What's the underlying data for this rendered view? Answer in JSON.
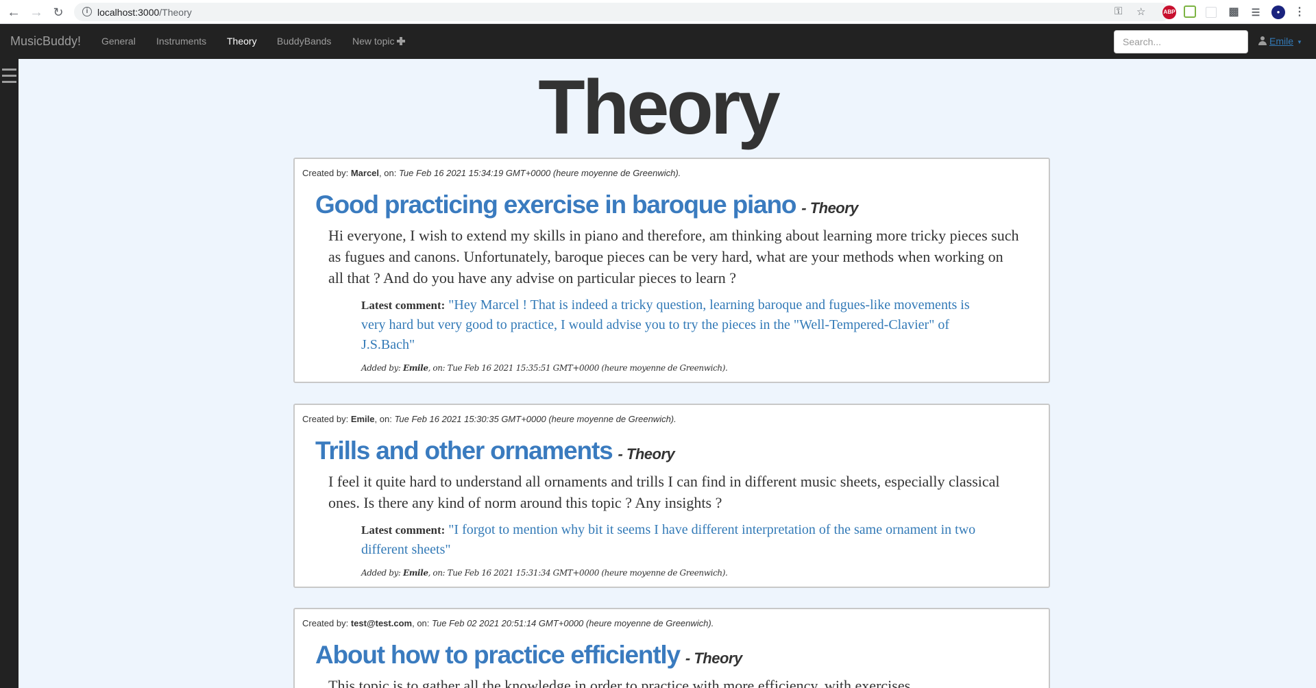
{
  "browser": {
    "url_host": "localhost:3000",
    "url_path": "/Theory"
  },
  "navbar": {
    "brand": "MusicBuddy!",
    "items": [
      {
        "label": "General",
        "active": false
      },
      {
        "label": "Instruments",
        "active": false
      },
      {
        "label": "Theory",
        "active": true
      },
      {
        "label": "BuddyBands",
        "active": false
      },
      {
        "label": "New topic",
        "active": false
      }
    ],
    "search_placeholder": "Search...",
    "user": "Emile"
  },
  "page": {
    "title": "Theory"
  },
  "posts": [
    {
      "created_label": "Created by: ",
      "author": "Marcel",
      "on_label": ", on: ",
      "date": "Tue Feb 16 2021 15:34:19 GMT+0000 (heure moyenne de Greenwich).",
      "title": "Good practicing exercise in baroque piano",
      "category": "- Theory",
      "body": "Hi everyone, I wish to extend my skills in piano and therefore, am thinking about learning more tricky pieces such as fugues and canons. Unfortunately, baroque pieces can be very hard, what are your methods when working on all that ? And do you have any advise on particular pieces to learn ?",
      "comment_label": "Latest comment:",
      "comment": "\"Hey Marcel ! That is indeed a tricky question, learning baroque and fugues-like movements is very hard but very good to practice, I would advise you to try the pieces in the \"Well-Tempered-Clavier\" of J.S.Bach\"",
      "added_label": "Added by: ",
      "added_author": "Emile",
      "added_on_label": ", on: ",
      "added_date": "Tue Feb 16 2021 15:35:51 GMT+0000 (heure moyenne de Greenwich)."
    },
    {
      "created_label": "Created by: ",
      "author": "Emile",
      "on_label": ", on: ",
      "date": "Tue Feb 16 2021 15:30:35 GMT+0000 (heure moyenne de Greenwich).",
      "title": "Trills and other ornaments",
      "category": "- Theory",
      "body": "I feel it quite hard to understand all ornaments and trills I can find in different music sheets, especially classical ones. Is there any kind of norm around this topic ? Any insights ?",
      "comment_label": "Latest comment:",
      "comment": "\"I forgot to mention why bit it seems I have different interpretation of the same ornament in two different sheets\"",
      "added_label": "Added by: ",
      "added_author": "Emile",
      "added_on_label": ", on: ",
      "added_date": "Tue Feb 16 2021 15:31:34 GMT+0000 (heure moyenne de Greenwich)."
    },
    {
      "created_label": "Created by: ",
      "author": "test@test.com",
      "on_label": ", on: ",
      "date": "Tue Feb 02 2021 20:51:14 GMT+0000 (heure moyenne de Greenwich).",
      "title": "About how to practice efficiently",
      "category": "- Theory",
      "body": "This topic is to gather all the knowledge in order to practice with more efficiency, with exercises"
    }
  ]
}
